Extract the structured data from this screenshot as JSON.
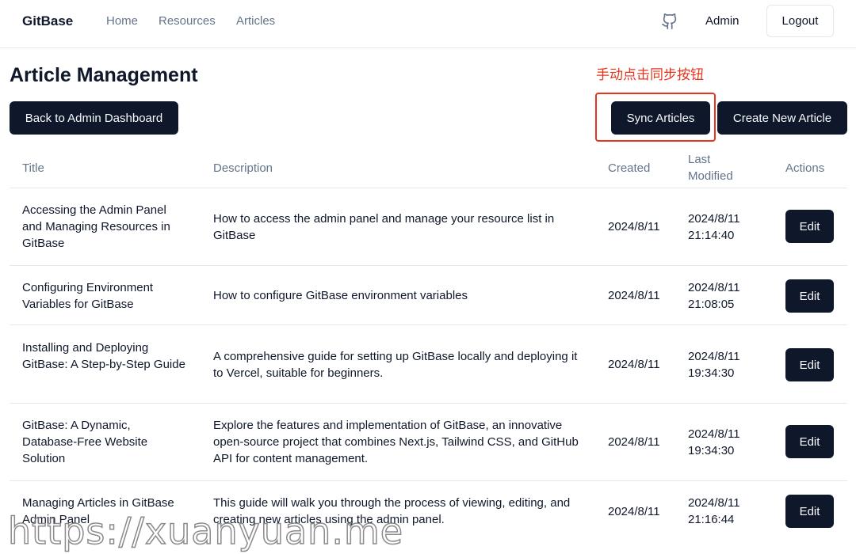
{
  "header": {
    "brand": "GitBase",
    "nav": [
      "Home",
      "Resources",
      "Articles"
    ],
    "github_icon": "github-icon",
    "user_label": "Admin",
    "logout_label": "Logout"
  },
  "page": {
    "title": "Article Management",
    "annotation": "手动点击同步按钮",
    "annotation_color": "#e8341c",
    "back_label": "Back to Admin Dashboard",
    "sync_label": "Sync Articles",
    "create_label": "Create New Article"
  },
  "table": {
    "headers": {
      "title": "Title",
      "description": "Description",
      "created": "Created",
      "modified_1": "Last",
      "modified_2": "Modified",
      "actions": "Actions"
    },
    "edit_label": "Edit",
    "rows": [
      {
        "title": "Accessing the Admin Panel and Managing Resources in GitBase",
        "description": "How to access the admin panel and manage your resource list in GitBase",
        "created": "2024/8/11",
        "modified_date": "2024/8/11",
        "modified_time": "21:14:40"
      },
      {
        "title": "Configuring Environment Variables for GitBase",
        "description": "How to configure GitBase environment variables",
        "created": "2024/8/11",
        "modified_date": "2024/8/11",
        "modified_time": "21:08:05"
      },
      {
        "title": "Installing and Deploying GitBase: A Step-by-Step Guide",
        "description": "A comprehensive guide for setting up GitBase locally and deploying it to Vercel, suitable for beginners.",
        "created": "2024/8/11",
        "modified_date": "2024/8/11",
        "modified_time": "19:34:30"
      },
      {
        "title": "GitBase: A Dynamic, Database-Free Website Solution",
        "description": "Explore the features and implementation of GitBase, an innovative open-source project that combines Next.js, Tailwind CSS, and GitHub API for content management.",
        "created": "2024/8/11",
        "modified_date": "2024/8/11",
        "modified_time": "19:34:30"
      },
      {
        "title": "Managing Articles in GitBase Admin Panel",
        "description": "This guide will walk you through the process of viewing, editing, and creating new articles using the admin panel.",
        "created": "2024/8/11",
        "modified_date": "2024/8/11",
        "modified_time": "21:16:44"
      }
    ]
  },
  "watermark": "https://xuanyuan.me"
}
